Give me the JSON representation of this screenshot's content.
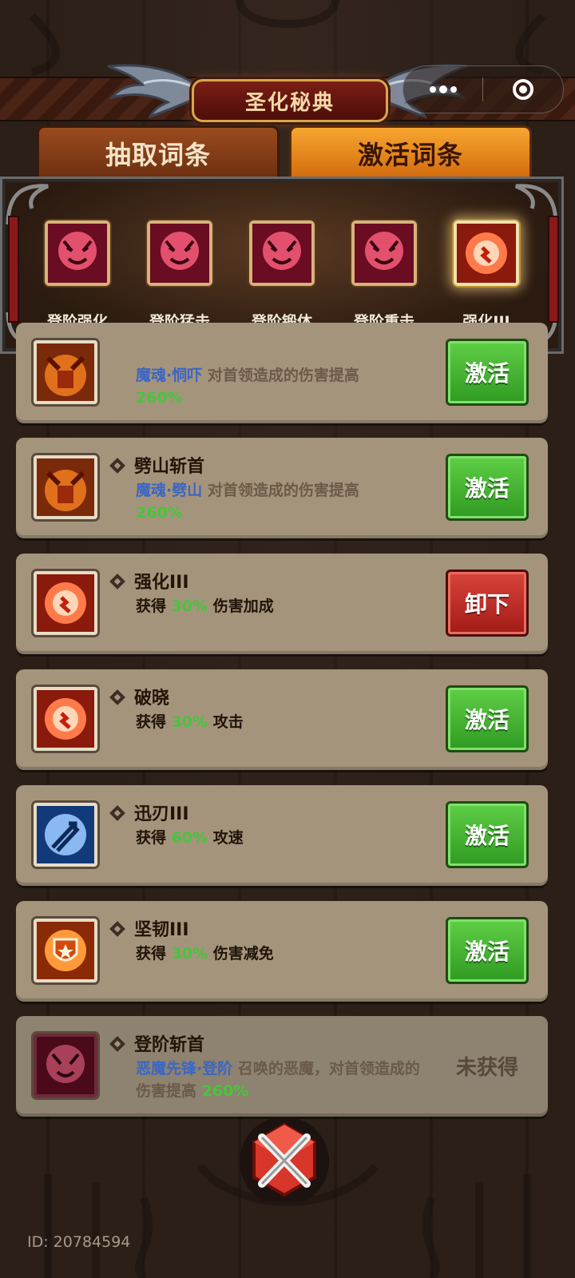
{
  "header": {
    "title": "圣化秘典"
  },
  "capsule": {
    "more_icon": "ellipsis-icon",
    "close_icon": "target-icon"
  },
  "tabs": [
    {
      "label": "抽取词条",
      "active": false
    },
    {
      "label": "激活词条",
      "active": true
    }
  ],
  "equipped_slots": [
    {
      "label": "登阶强化",
      "icon": "demon-icon"
    },
    {
      "label": "登阶猛击",
      "icon": "demon-icon"
    },
    {
      "label": "登阶锻体",
      "icon": "demon-icon"
    },
    {
      "label": "登阶重击",
      "icon": "demon-icon"
    },
    {
      "label": "强化III",
      "icon": "flame-burst-icon",
      "selected": true
    }
  ],
  "entries": [
    {
      "name": "",
      "desc": {
        "tag": "魔魂·恫吓",
        "text": " 对首领造成的伤害提高",
        "value": "260%"
      },
      "button": "激活",
      "icon": "demon-knight-icon"
    },
    {
      "name": "劈山斩首",
      "desc": {
        "tag": "魔魂·劈山",
        "text": " 对首领造成的伤害提高",
        "value": "260%"
      },
      "button": "激活",
      "icon": "demon-knight-icon"
    },
    {
      "name": "强化III",
      "desc": {
        "prefix": "获得 ",
        "value": "30%",
        "suffix": " 伤害加成"
      },
      "button": "卸下",
      "icon": "flame-burst-icon"
    },
    {
      "name": "破晓",
      "desc": {
        "prefix": "获得 ",
        "value": "30%",
        "suffix": " 攻击"
      },
      "button": "激活",
      "icon": "flame-burst-icon"
    },
    {
      "name": "迅刃III",
      "desc": {
        "prefix": "获得 ",
        "value": "60%",
        "suffix": " 攻速"
      },
      "button": "激活",
      "icon": "blue-arrows-icon"
    },
    {
      "name": "坚韧III",
      "desc": {
        "prefix": "获得 ",
        "value": "30%",
        "suffix": " 伤害减免"
      },
      "button": "激活",
      "icon": "star-shield-icon"
    },
    {
      "name": "登阶斩首",
      "desc": {
        "tag": "恶魔先锋·登阶",
        "text": " 召唤的恶魔，对首领造成的伤害提高 ",
        "value": "260%"
      },
      "status": "未获得",
      "icon": "demon-icon"
    }
  ],
  "footer": {
    "player_id": "ID: 20784594",
    "close_icon": "crossed-swords-close-icon"
  },
  "colors": {
    "accent_green": "#46c63a",
    "tag_blue": "#3b66c4",
    "button_green": "#3fae2c",
    "button_red": "#c0302a"
  }
}
